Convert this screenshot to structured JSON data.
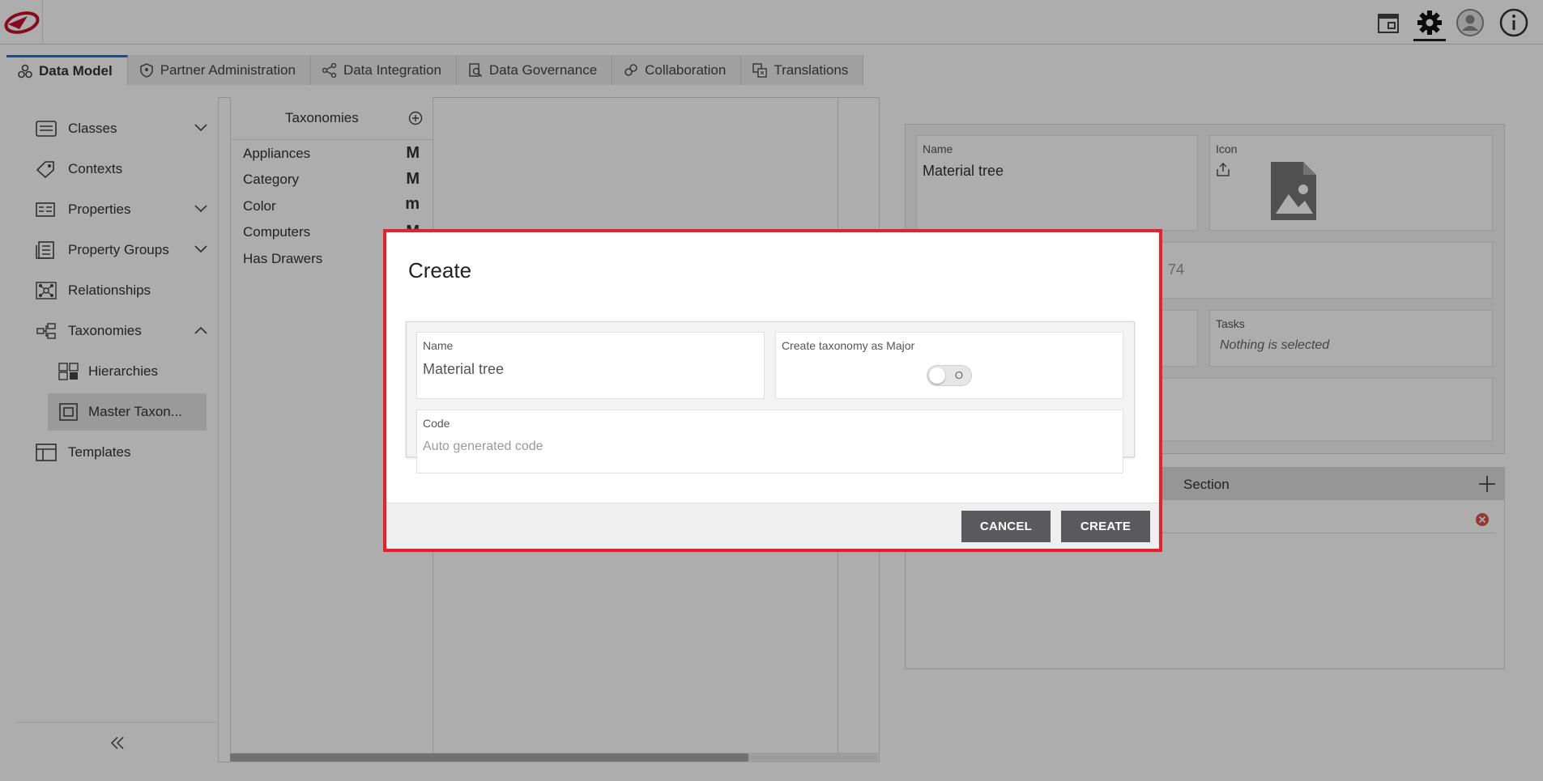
{
  "tabs": [
    {
      "label": "Data Model",
      "icon": "data-model-icon",
      "active": true
    },
    {
      "label": "Partner Administration",
      "icon": "shield-icon"
    },
    {
      "label": "Data Integration",
      "icon": "integration-icon"
    },
    {
      "label": "Data Governance",
      "icon": "governance-icon"
    },
    {
      "label": "Collaboration",
      "icon": "collaboration-icon"
    },
    {
      "label": "Translations",
      "icon": "translations-icon"
    }
  ],
  "sidebar": {
    "items": [
      {
        "label": "Classes",
        "icon": "classes-icon",
        "expandable": true
      },
      {
        "label": "Contexts",
        "icon": "tag-icon"
      },
      {
        "label": "Properties",
        "icon": "properties-icon",
        "expandable": true
      },
      {
        "label": "Property Groups",
        "icon": "property-groups-icon",
        "expandable": true
      },
      {
        "label": "Relationships",
        "icon": "relationships-icon"
      },
      {
        "label": "Taxonomies",
        "icon": "taxonomies-icon",
        "expanded": true
      },
      {
        "label": "Hierarchies",
        "icon": "hierarchies-icon",
        "sub": true
      },
      {
        "label": "Master Taxon...",
        "icon": "master-taxonomy-icon",
        "sub": true,
        "selected": true
      },
      {
        "label": "Templates",
        "icon": "templates-icon"
      }
    ]
  },
  "taxonomies": {
    "title": "Taxonomies",
    "rows": [
      {
        "label": "Appliances",
        "badge": "M"
      },
      {
        "label": "Category",
        "badge": "M"
      },
      {
        "label": "Color",
        "badge": "m"
      },
      {
        "label": "Computers",
        "badge": "M"
      },
      {
        "label": "Has Drawers",
        "badge": ""
      }
    ]
  },
  "detail": {
    "name_label": "Name",
    "name_value": "Material tree",
    "icon_label": "Icon",
    "code_fragment": "74",
    "tasks_label": "Tasks",
    "tasks_value": "Nothing is selected",
    "section_title": "Section"
  },
  "modal": {
    "title": "Create",
    "name_label": "Name",
    "name_value": "Material tree",
    "major_label": "Create taxonomy as Major",
    "toggle_state": "O",
    "code_label": "Code",
    "code_placeholder": "Auto generated code",
    "cancel_label": "CANCEL",
    "create_label": "CREATE"
  },
  "colors": {
    "accent_tab": "#2f6fbd",
    "modal_border": "#e8202a",
    "button_bg": "#5a5a5c",
    "logo_red": "#c8102e"
  }
}
